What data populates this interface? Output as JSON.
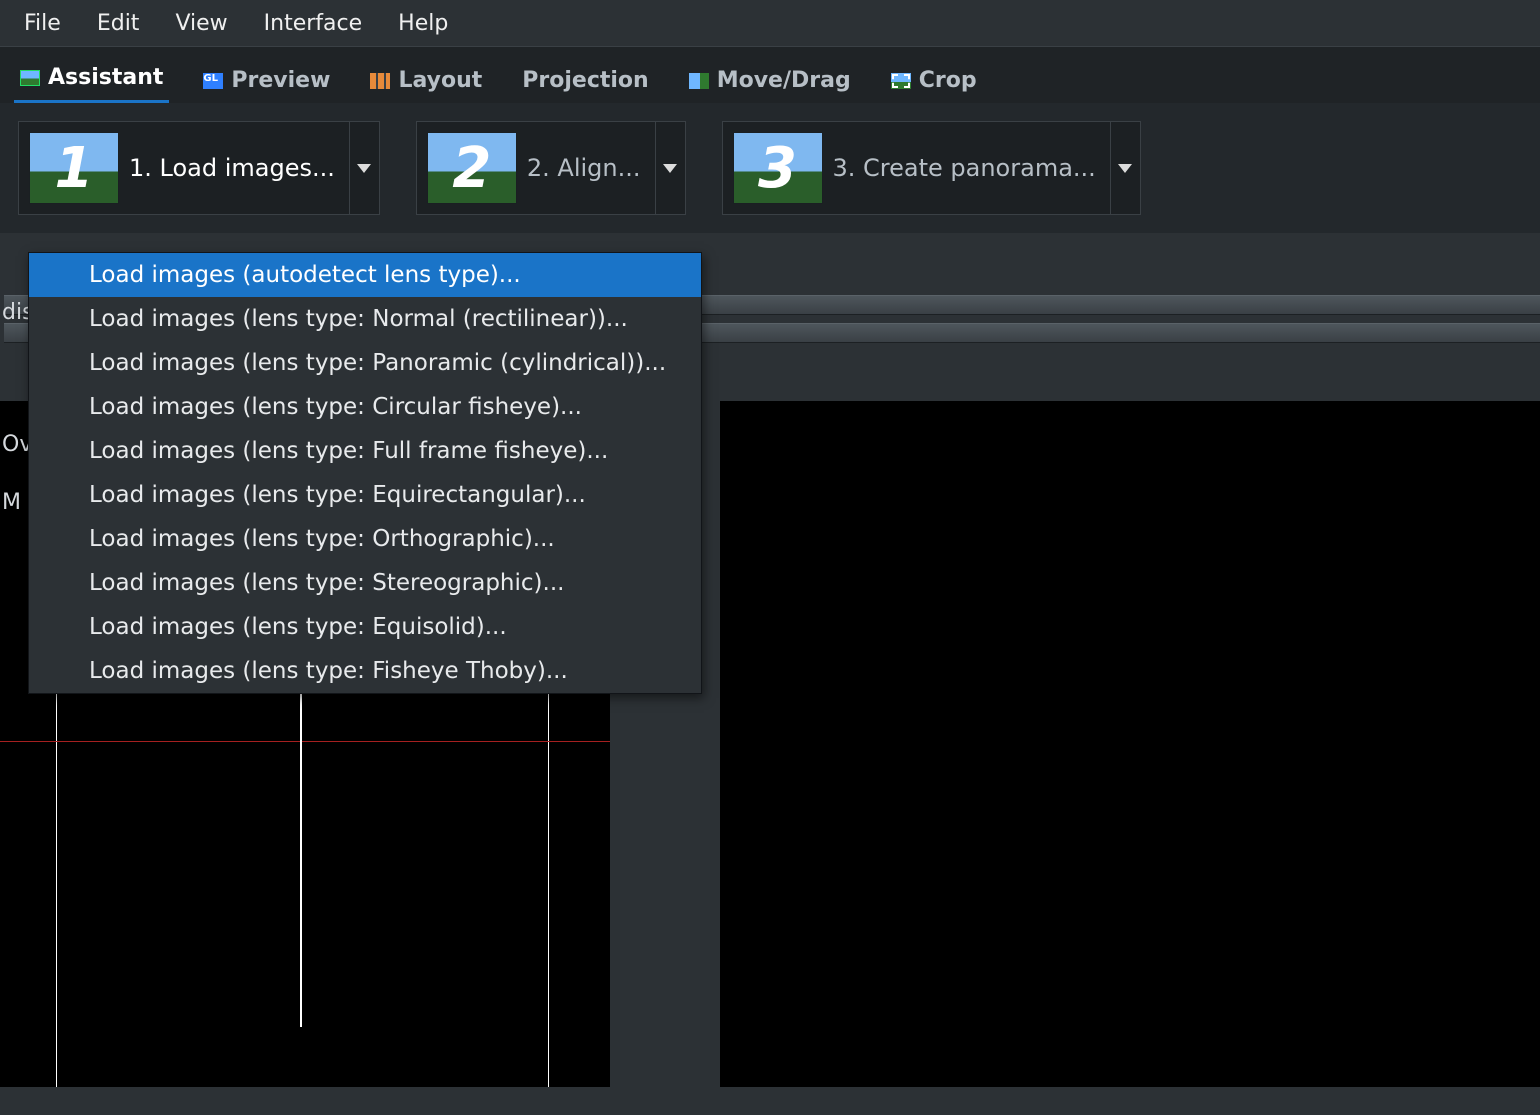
{
  "menubar": [
    "File",
    "Edit",
    "View",
    "Interface",
    "Help"
  ],
  "tabs": [
    {
      "label": "Assistant",
      "active": true
    },
    {
      "label": "Preview",
      "active": false
    },
    {
      "label": "Layout",
      "active": false
    },
    {
      "label": "Projection",
      "active": false
    },
    {
      "label": "Move/Drag",
      "active": false
    },
    {
      "label": "Crop",
      "active": false
    }
  ],
  "steps": [
    {
      "num": "1",
      "label": "1. Load images...",
      "enabled": true
    },
    {
      "num": "2",
      "label": "2. Align...",
      "enabled": false
    },
    {
      "num": "3",
      "label": "3. Create panorama...",
      "enabled": false
    }
  ],
  "dropdown": {
    "items": [
      "Load images (autodetect lens type)...",
      "Load images (lens type: Normal (rectilinear))...",
      "Load images (lens type: Panoramic (cylindrical))...",
      "Load images (lens type: Circular fisheye)...",
      "Load images (lens type: Full frame fisheye)...",
      "Load images (lens type: Equirectangular)...",
      "Load images (lens type: Orthographic)...",
      "Load images (lens type: Stereographic)...",
      "Load images (lens type: Equisolid)...",
      "Load images (lens type: Fisheye Thoby)..."
    ],
    "hover_index": 0
  },
  "peek": {
    "dis": "dis",
    "ov": "Ov",
    "m": "M"
  }
}
